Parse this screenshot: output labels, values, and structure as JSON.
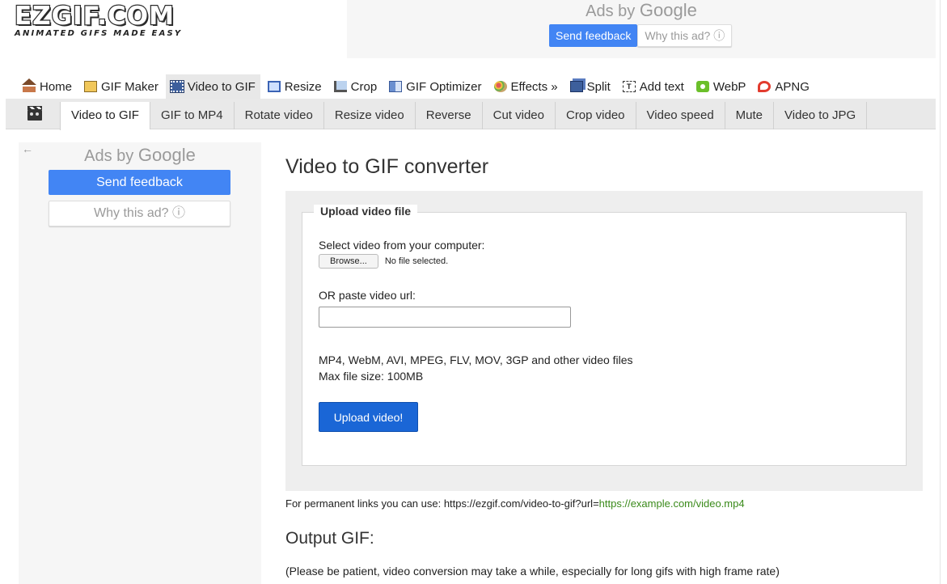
{
  "logo": {
    "name": "EZGIF.COM",
    "tagline": "ANIMATED GIFS MADE EASY"
  },
  "top_ad": {
    "ads_by": "Ads by",
    "google": "Google",
    "send_feedback": "Send feedback",
    "why_this_ad": "Why this ad? ⓘ"
  },
  "main_menu": [
    {
      "label": "Home",
      "icon": "home-icon"
    },
    {
      "label": "GIF Maker",
      "icon": "gif-maker-icon"
    },
    {
      "label": "Video to GIF",
      "icon": "video-icon",
      "active": true
    },
    {
      "label": "Resize",
      "icon": "resize-icon"
    },
    {
      "label": "Crop",
      "icon": "crop-icon"
    },
    {
      "label": "GIF Optimizer",
      "icon": "optimizer-icon"
    },
    {
      "label": "Effects »",
      "icon": "effects-icon"
    },
    {
      "label": "Split",
      "icon": "split-icon"
    },
    {
      "label": "Add text",
      "icon": "add-text-icon"
    },
    {
      "label": "WebP",
      "icon": "webp-icon"
    },
    {
      "label": "APNG",
      "icon": "apng-icon"
    }
  ],
  "sub_menu": [
    {
      "label": "Video to GIF",
      "active": true
    },
    {
      "label": "GIF to MP4"
    },
    {
      "label": "Rotate video"
    },
    {
      "label": "Resize video"
    },
    {
      "label": "Reverse"
    },
    {
      "label": "Cut video"
    },
    {
      "label": "Crop video"
    },
    {
      "label": "Video speed"
    },
    {
      "label": "Mute"
    },
    {
      "label": "Video to JPG"
    }
  ],
  "left_ad": {
    "back": "←",
    "ads_by": "Ads by",
    "google": "Google",
    "send_feedback": "Send feedback",
    "why_this_ad": "Why this ad? ⓘ"
  },
  "main": {
    "title": "Video to GIF converter",
    "legend": "Upload video file",
    "select_label": "Select video from your computer:",
    "browse_label": "Browse...",
    "no_file": "No file selected.",
    "url_label": "OR paste video url:",
    "url_value": "",
    "formats_line1": "MP4, WebM, AVI, MPEG, FLV, MOV, 3GP and other video files",
    "formats_line2": "Max file size: 100MB",
    "upload_button": "Upload video!",
    "permanent_prefix": "For permanent links you can use: https://ezgif.com/video-to-gif?url=",
    "permanent_link": "https://example.com/video.mp4",
    "output_title": "Output GIF:",
    "patience_note": "(Please be patient, video conversion may take a while, especially for long gifs with high frame rate)"
  }
}
